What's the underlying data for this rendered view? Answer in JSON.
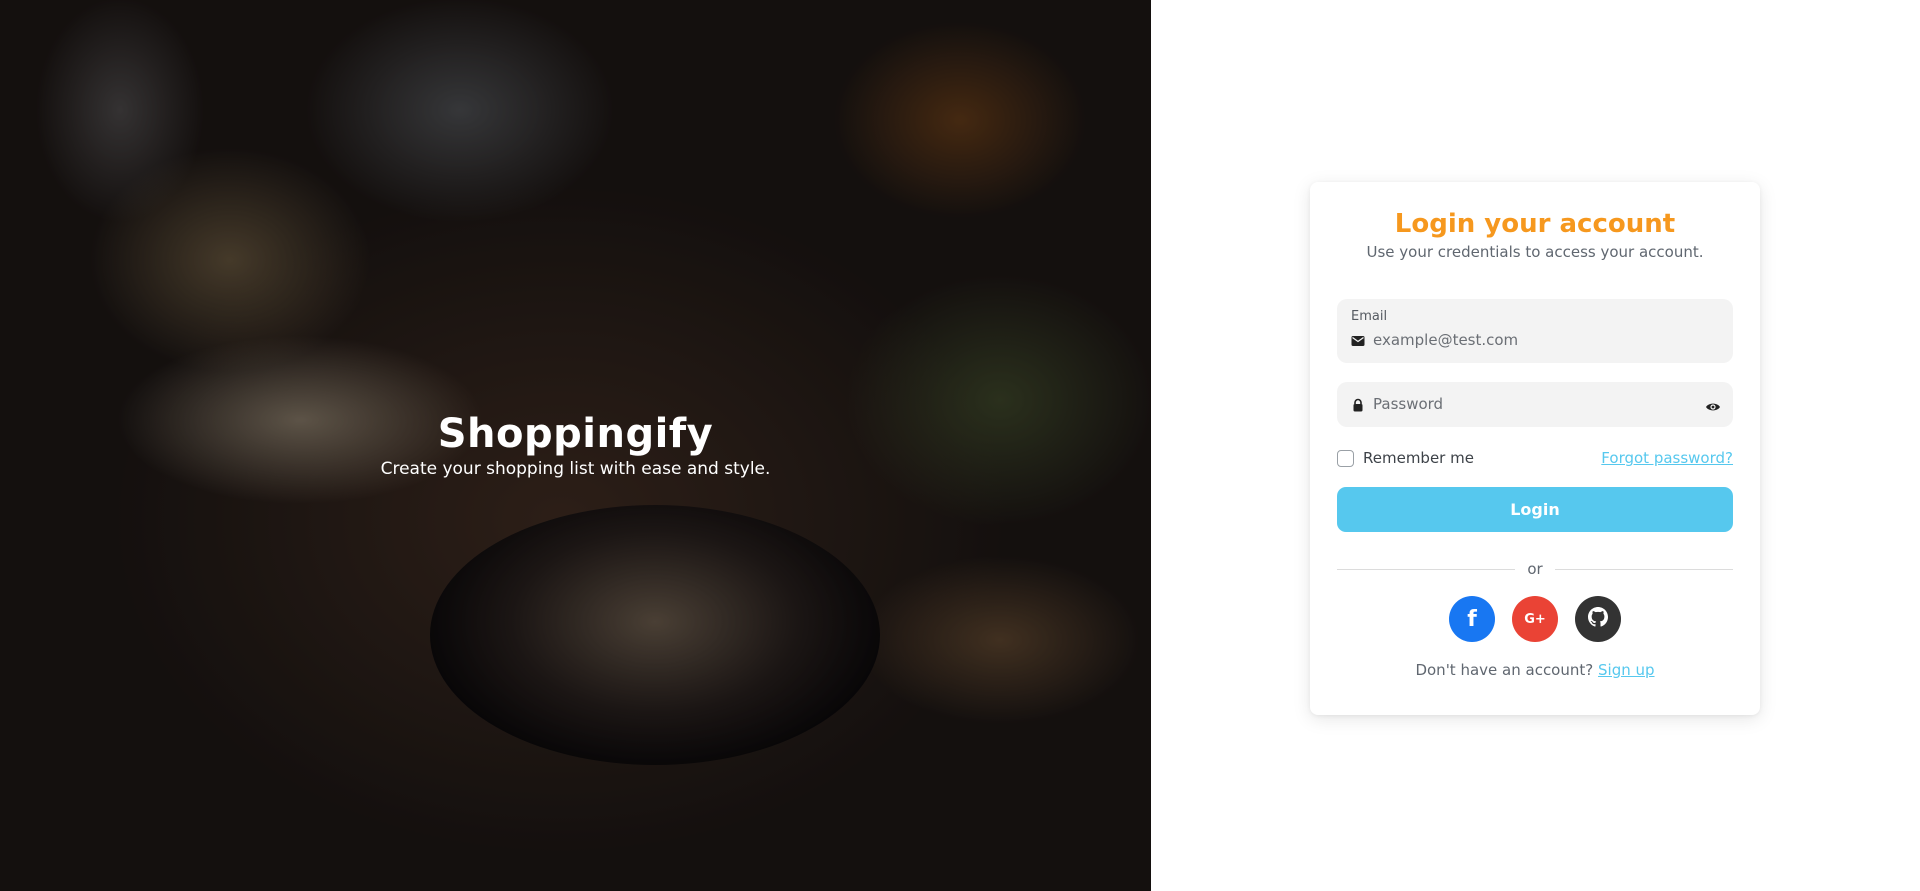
{
  "hero": {
    "title": "Shoppingify",
    "subtitle": "Create your shopping list with ease and style."
  },
  "login": {
    "title": "Login your account",
    "subtitle": "Use your credentials to access your account.",
    "email": {
      "label": "Email",
      "placeholder": "example@test.com",
      "value": "",
      "icon": "envelope-icon"
    },
    "password": {
      "placeholder": "Password",
      "value": "",
      "icon": "lock-icon",
      "toggle_icon": "eye-icon"
    },
    "remember_label": "Remember me",
    "remember_checked": false,
    "forgot_label": "Forgot password?",
    "submit_label": "Login",
    "divider_text": "or",
    "socials": [
      {
        "name": "facebook",
        "glyph": "f",
        "color": "#1877f2"
      },
      {
        "name": "google-plus",
        "glyph": "G+",
        "color": "#ea4335"
      },
      {
        "name": "github",
        "glyph": "",
        "color": "#333333"
      }
    ],
    "signup_prompt": "Don't have an account?",
    "signup_link": "Sign up"
  },
  "colors": {
    "accent_title": "#f6981e",
    "primary_button": "#56c8ee",
    "link": "#56c8ee"
  }
}
